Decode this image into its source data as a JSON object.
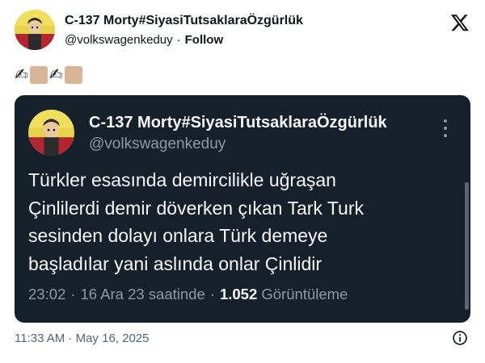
{
  "author": {
    "display_name": "C-137 Morty#SiyasiTutsaklaraÖzgürlük",
    "handle": "@volkswagenkeduy",
    "separator": "·",
    "follow_label": "Follow"
  },
  "emoji_line": {
    "items": [
      "writing-hand",
      "skin-tone-swatch",
      "writing-hand",
      "skin-tone-swatch"
    ],
    "glyph": "✍",
    "skin_color": "#d7b696"
  },
  "quoted": {
    "display_name": "C-137 Morty#SiyasiTutsaklaraÖzgürlük",
    "handle": "@volkswagenkeduy",
    "text_lines": [
      "Türkler esasında demircilikle uğraşan",
      "Çinlilerdi demir döverken çıkan Tark Turk",
      "sesinden dolayı onlara Türk demeye",
      "başladılar yani aslında onlar Çinlidir"
    ],
    "time": "23:02",
    "sep1": "·",
    "date": "16 Ara 23 saatinde",
    "sep2": "·",
    "views_count": "1.052",
    "views_label": "Görüntüleme",
    "background": "#15202b"
  },
  "footer": {
    "timestamp": "11:33 AM · May 16, 2025"
  },
  "colors": {
    "text_primary": "#0f1419",
    "text_secondary": "#536471",
    "card_text": "#f7f9f9",
    "card_muted": "#8b98a5"
  }
}
